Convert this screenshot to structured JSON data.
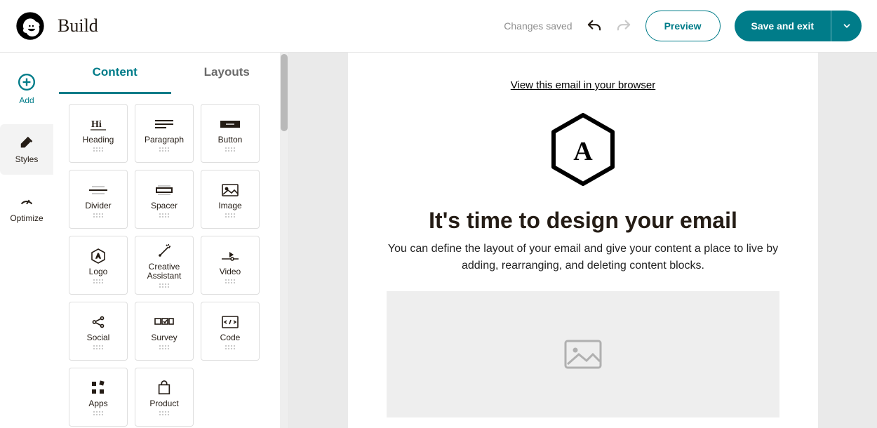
{
  "header": {
    "title": "Build",
    "saved": "Changes saved",
    "preview": "Preview",
    "save": "Save and exit"
  },
  "rail": {
    "add": "Add",
    "styles": "Styles",
    "optimize": "Optimize"
  },
  "tabs": {
    "content": "Content",
    "layouts": "Layouts"
  },
  "blocks": {
    "heading": "Heading",
    "paragraph": "Paragraph",
    "button": "Button",
    "divider": "Divider",
    "spacer": "Spacer",
    "image": "Image",
    "logo": "Logo",
    "creative": "Creative Assistant",
    "video": "Video",
    "social": "Social",
    "survey": "Survey",
    "code": "Code",
    "apps": "Apps",
    "product": "Product"
  },
  "canvas": {
    "view_link": "View this email in your browser",
    "headline": "It's time to design your email",
    "sub": "You can define the layout of your email and give your content a place to live by adding, rearranging, and deleting content blocks."
  }
}
